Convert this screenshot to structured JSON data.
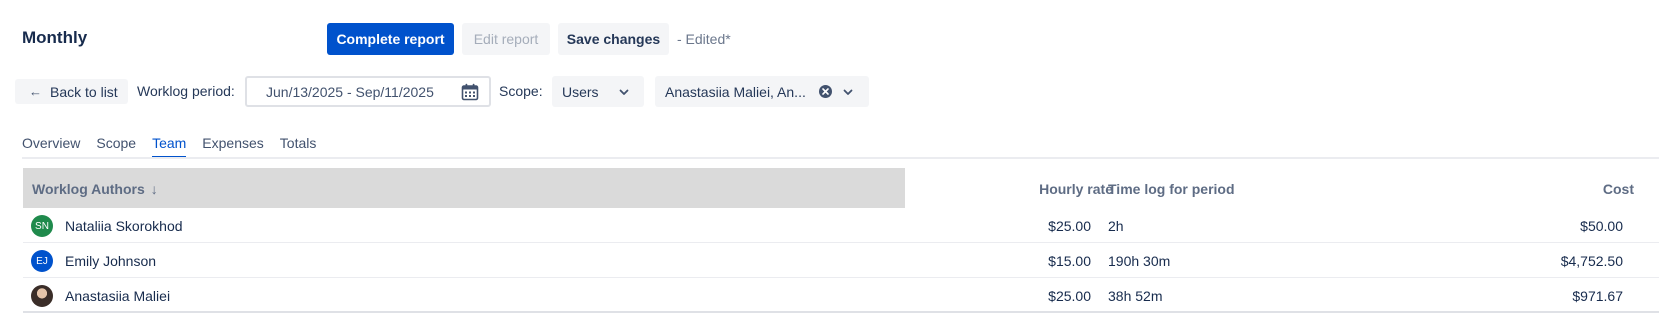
{
  "header": {
    "title": "Monthly",
    "complete_report_label": "Complete report",
    "edit_report_label": "Edit report",
    "save_changes_label": "Save changes",
    "edited_status": "- Edited*"
  },
  "filters": {
    "back_label": "Back to list",
    "period_label": "Worklog period:",
    "period_value": "Jun/13/2025 - Sep/11/2025",
    "scope_label": "Scope:",
    "scope_value": "Users",
    "users_value": "Anastasiia Maliei, An..."
  },
  "tabs": [
    {
      "label": "Overview",
      "active": false
    },
    {
      "label": "Scope",
      "active": false
    },
    {
      "label": "Team",
      "active": true
    },
    {
      "label": "Expenses",
      "active": false
    },
    {
      "label": "Totals",
      "active": false
    }
  ],
  "table": {
    "columns": {
      "authors": "Worklog Authors",
      "rate": "Hourly rate",
      "timelog": "Time log for period",
      "cost": "Cost"
    },
    "rows": [
      {
        "initials": "SN",
        "name": "Nataliia Skorokhod",
        "rate": "$25.00",
        "timelog": "2h",
        "cost": "$50.00"
      },
      {
        "initials": "EJ",
        "name": "Emily Johnson",
        "rate": "$15.00",
        "timelog": "190h 30m",
        "cost": "$4,752.50"
      },
      {
        "initials": "",
        "name": "Anastasiia Maliei",
        "rate": "$25.00",
        "timelog": "38h 52m",
        "cost": "$971.67"
      }
    ]
  },
  "colors": {
    "primary": "#0052cc",
    "text": "#172b4d",
    "header_sorted_bg": "#dadada",
    "avatar_green": "#1f8a4c"
  },
  "icons": {
    "back": "arrow-left-icon",
    "calendar": "calendar-icon",
    "clear": "clear-icon",
    "dropdown": "chevron-down-icon",
    "sort": "arrow-down-icon"
  }
}
